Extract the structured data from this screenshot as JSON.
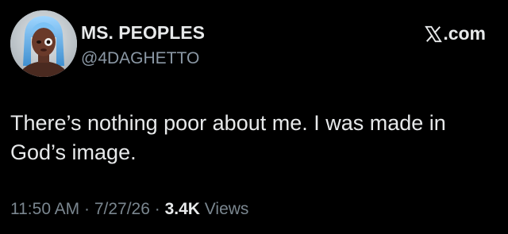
{
  "author": {
    "display_name": "MS. PEOPLES",
    "handle": "@4DAGHETTO"
  },
  "brand": {
    "label": ".com",
    "icon": "x-logo-icon"
  },
  "tweet": {
    "text_line1": "There’s nothing poor about me. I was made in",
    "text_line2": "God’s image."
  },
  "meta": {
    "time": "11:50 AM",
    "sep1": " · ",
    "date": "7/27/26",
    "sep2": " · ",
    "views_count": "3.4K",
    "views_label": " Views"
  },
  "colors": {
    "background": "#000000",
    "primary_text": "#e7e9ea",
    "secondary_text": "#8b98a5"
  }
}
